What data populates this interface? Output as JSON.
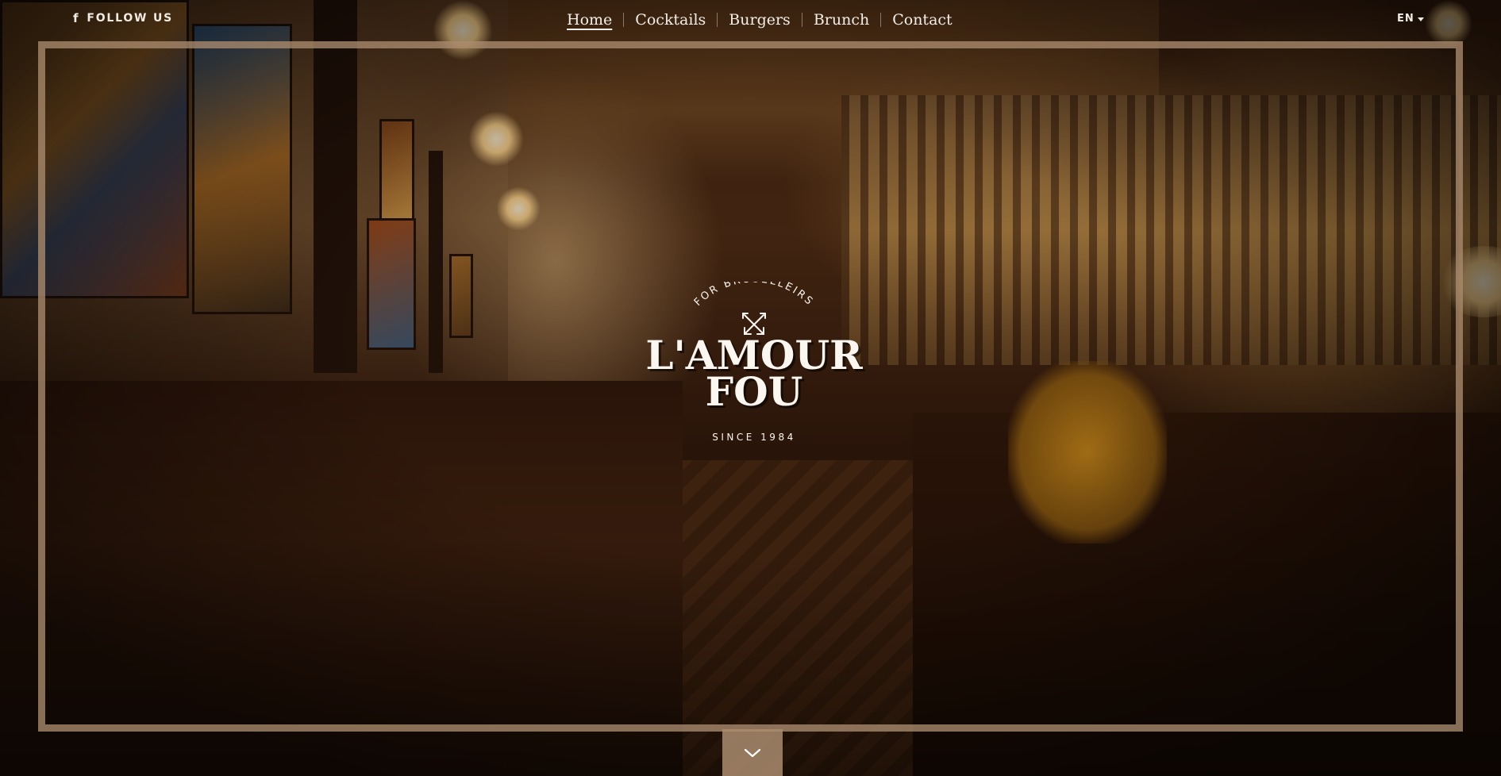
{
  "header": {
    "follow_label": "FOLLOW US",
    "follow_icon": "facebook-icon",
    "nav": [
      {
        "label": "Home",
        "active": true
      },
      {
        "label": "Cocktails",
        "active": false
      },
      {
        "label": "Burgers",
        "active": false
      },
      {
        "label": "Brunch",
        "active": false
      },
      {
        "label": "Contact",
        "active": false
      }
    ],
    "language": "EN"
  },
  "logo": {
    "tagline": "FOR BRUSELLEIRS",
    "name_line1": "L'AMOUR",
    "name_line2": "FOU",
    "since": "SINCE 1984"
  },
  "scroll_icon": "chevron-down-icon",
  "colors": {
    "frame": "#aa8c6e",
    "text": "#f4eee8",
    "scroll_button": "#aa8c6e"
  }
}
